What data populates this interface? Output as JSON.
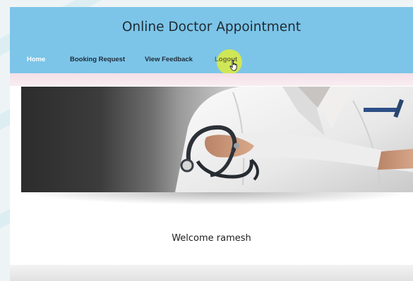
{
  "header": {
    "title": "Online Doctor Appointment"
  },
  "nav": {
    "home": "Home",
    "booking_request": "Booking Request",
    "view_feedback": "View Feedback",
    "logout": "Logout"
  },
  "main": {
    "welcome_text": "Welcome ramesh"
  },
  "colors": {
    "header_bg": "#7cc5e8",
    "active_nav": "#ffffff",
    "hover_highlight": "#deeb3c"
  },
  "icons": {
    "cursor": "hand-pointer-icon"
  }
}
